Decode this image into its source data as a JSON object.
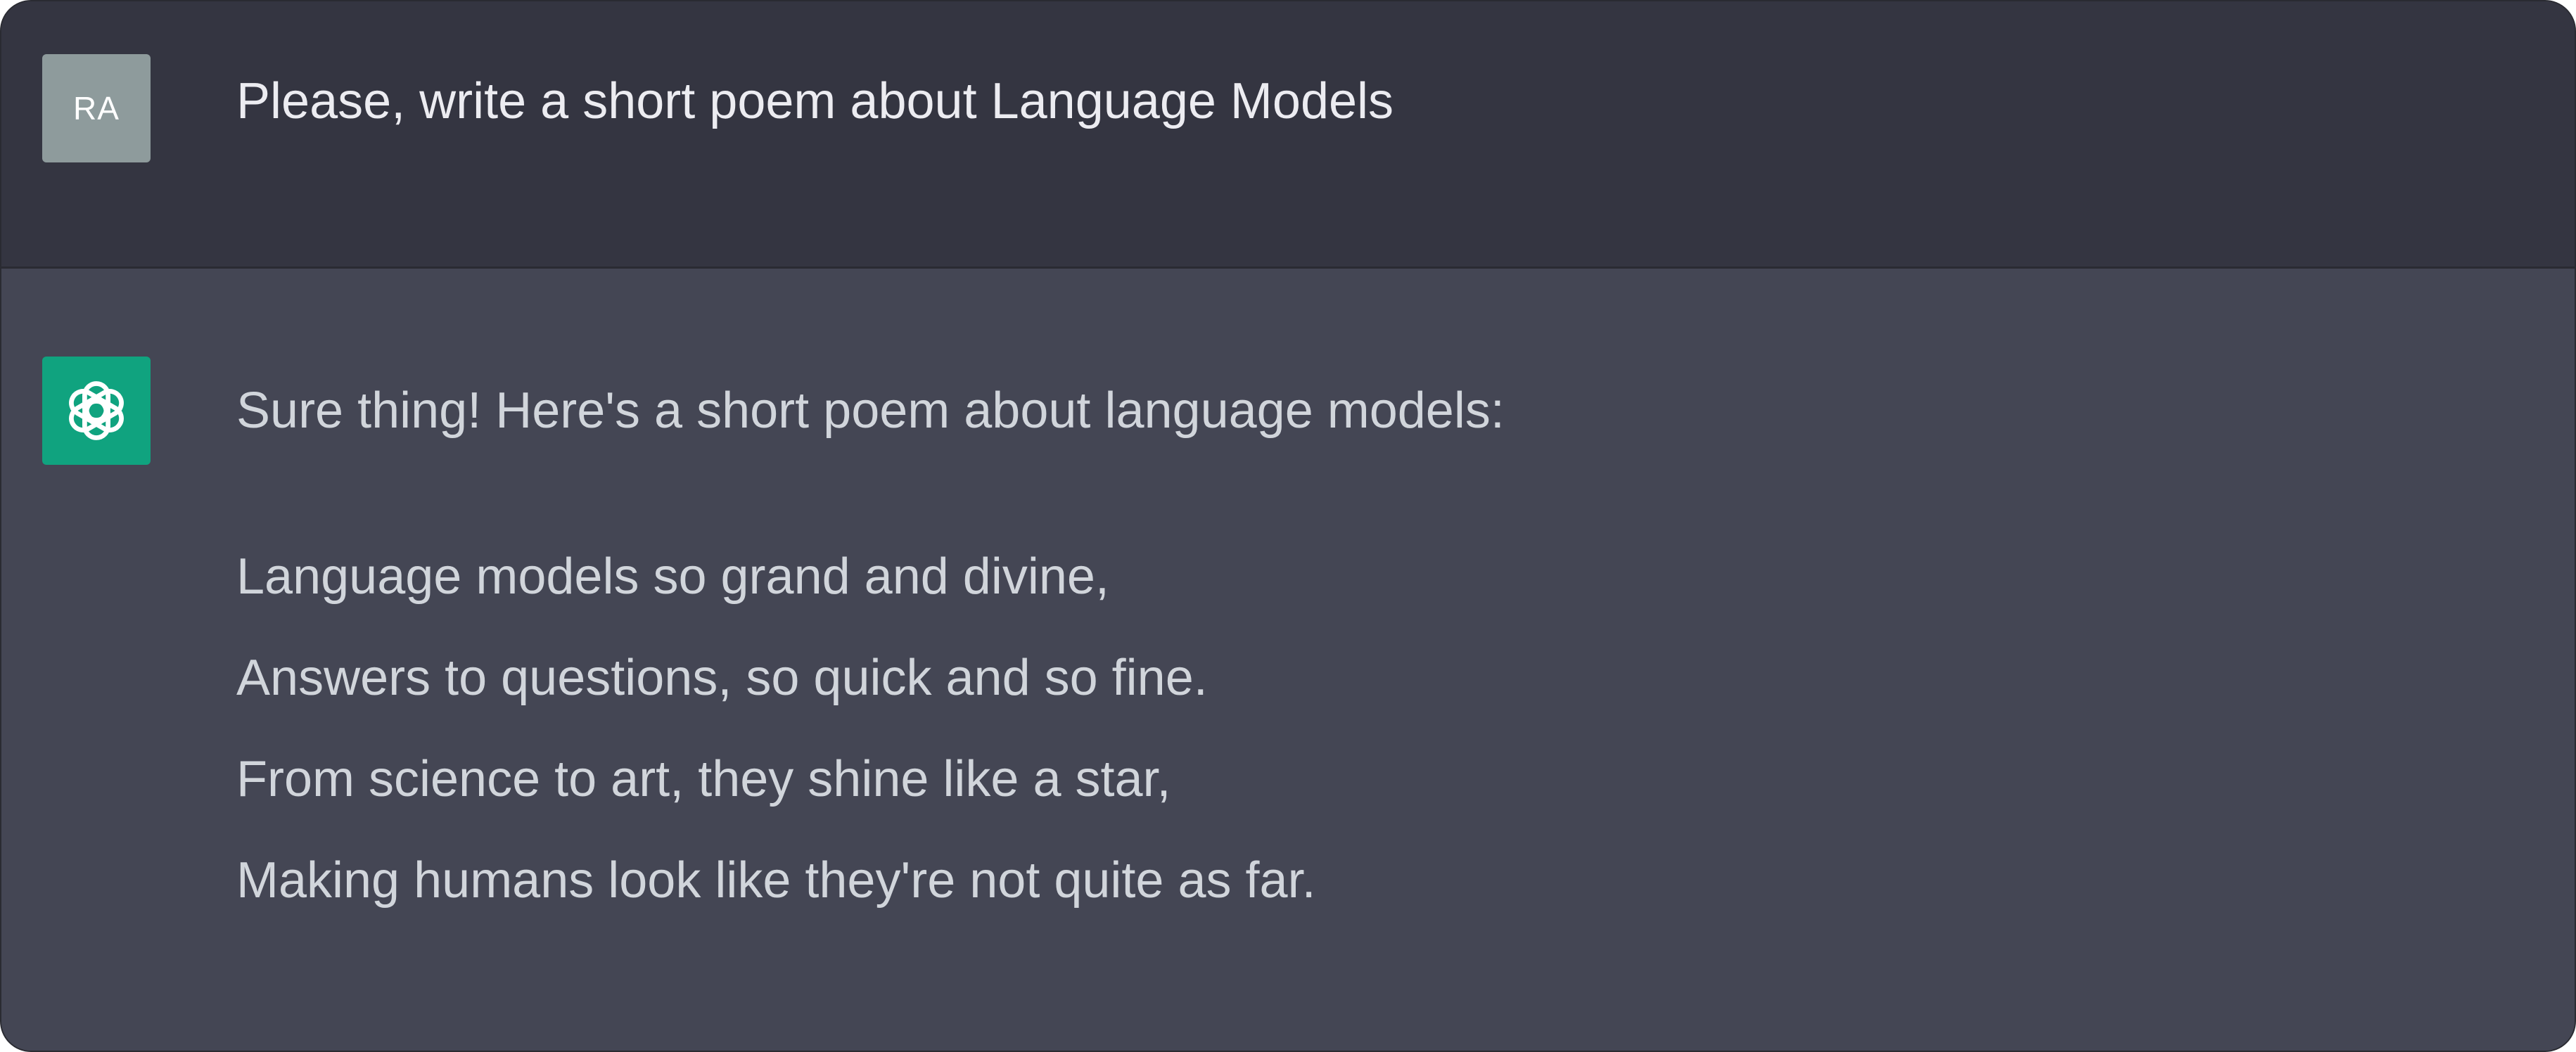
{
  "user_message": {
    "avatar_initials": "RA",
    "text": "Please, write a short poem about Language Models"
  },
  "assistant_message": {
    "intro": "Sure thing! Here's a short poem about language models:",
    "poem_lines": [
      "Language models so grand and divine,",
      "Answers to questions, so quick and so fine.",
      "From science to art, they shine like a star,",
      "Making humans look like they're not quite as far."
    ],
    "avatar_icon": "openai-logo-icon"
  },
  "colors": {
    "user_row_bg": "#343541",
    "assistant_row_bg": "#444654",
    "user_avatar_bg": "#8e9b9c",
    "assistant_avatar_bg": "#10a37f",
    "user_text": "#ececf1",
    "assistant_text": "#d1d5db"
  }
}
